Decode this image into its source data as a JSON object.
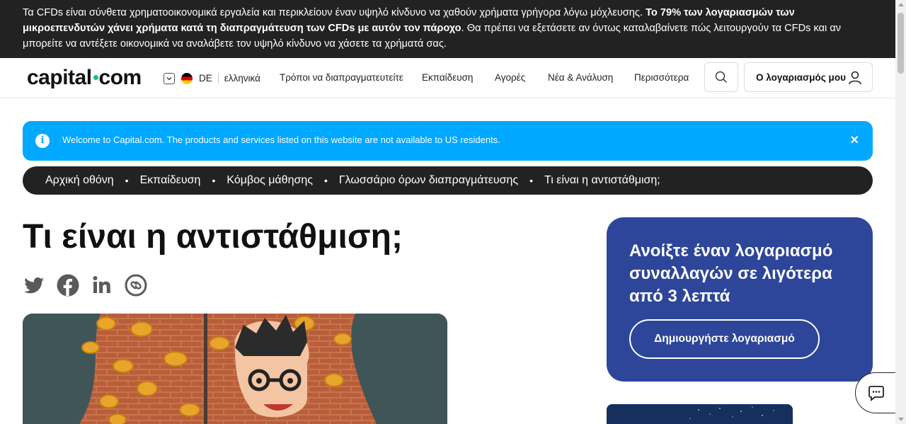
{
  "risk_warning": {
    "text_before": "Τα CFDs είναι σύνθετα χρηματοοικονομικά εργαλεία και περικλείουν έναν υψηλό κίνδυνο να χαθούν χρήματα γρήγορα λόγω μόχλευσης. ",
    "text_bold": "Το 79% των λογαριασμών των μικροεπενδυτών χάνει χρήματα κατά τη διαπραγμάτευση των CFDs με αυτόν τον πάροχο",
    "text_after": ". Θα πρέπει να εξετάσετε αν όντως καταλαβαίνετε πώς λειτουργούν τα CFDs και αν μπορείτε να αντέξετε οικονομικά να αναλάβετε τον υψηλό κίνδυνο να χάσετε τα χρήματά σας."
  },
  "header": {
    "logo_left": "capital",
    "logo_right": "com",
    "region_code": "DE",
    "language": "ελληνικά",
    "nav": [
      {
        "label": "Τρόποι να διαπραγματευτείτε"
      },
      {
        "label": "Εκπαίδευση"
      },
      {
        "label": "Αγορές"
      },
      {
        "label": "Νέα & Ανάλυση"
      },
      {
        "label": "Περισσότερα"
      }
    ],
    "search_icon": "search-icon",
    "account_label": "Ο λογαριασμός μου",
    "account_icon": "user-icon"
  },
  "notice": {
    "message": "Welcome to Capital.com. The products and services listed on this website are not available to US residents.",
    "info_glyph": "i",
    "close_glyph": "×",
    "color": "#00a8ff"
  },
  "breadcrumb": {
    "items": [
      {
        "label": "Αρχική οθόνη"
      },
      {
        "label": "Εκπαίδευση"
      },
      {
        "label": "Κόμβος μάθησης"
      },
      {
        "label": "Γλωσσάριο όρων διαπραγμάτευσης"
      },
      {
        "label": "Τι είναι η αντιστάθμιση;"
      }
    ],
    "separator": "•"
  },
  "article": {
    "title": "Τι είναι η αντιστάθμιση;",
    "share_icons": [
      "twitter-icon",
      "facebook-icon",
      "linkedin-icon",
      "copy-link-icon"
    ]
  },
  "cta": {
    "heading": "Ανοίξτε έναν λογαριασμό συναλλαγών σε λιγότερα από 3 λεπτά",
    "button": "Δημιουργήστε λογαριασμό",
    "color": "#2d4699"
  },
  "chat": {
    "icon": "chat-icon"
  },
  "colors": {
    "dark": "#222222",
    "brand_green": "#1cb88b"
  }
}
